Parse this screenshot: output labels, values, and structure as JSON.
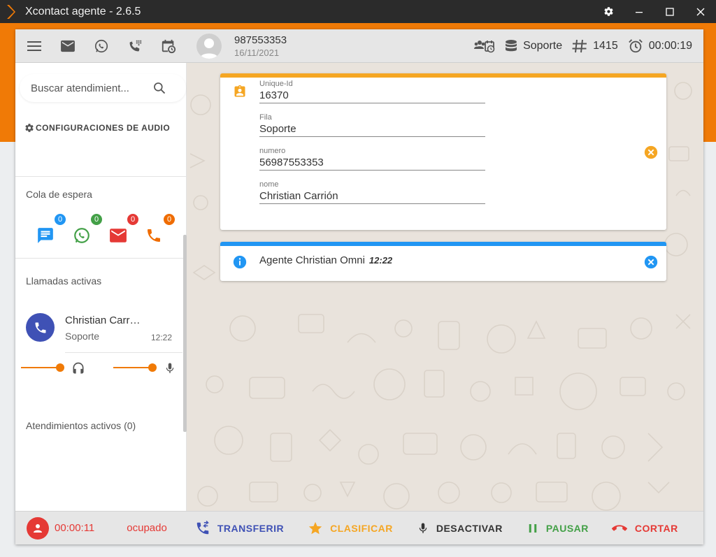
{
  "window": {
    "title": "Xcontact agente - 2.6.5"
  },
  "header": {
    "caller_number": "987553353",
    "caller_date": "16/11/2021",
    "queue": "Soporte",
    "extension": "1415",
    "timer": "00:00:19"
  },
  "sidebar": {
    "search_placeholder": "Buscar atendimient...",
    "audio_config_label": "CONFIGURACIONES DE AUDIO",
    "queue_label": "Cola de espera",
    "queue_counts": [
      {
        "channel": "chat",
        "count": "0",
        "color": "#2196f3"
      },
      {
        "channel": "whatsapp",
        "count": "0",
        "color": "#43a047"
      },
      {
        "channel": "email",
        "count": "0",
        "color": "#e53935"
      },
      {
        "channel": "phone",
        "count": "0",
        "color": "#ef6c00"
      }
    ],
    "active_calls_label": "Llamadas activas",
    "active_call": {
      "name": "Christian Carrión",
      "queue": "Soporte",
      "time": "12:22"
    },
    "headset_volume": 1.0,
    "mic_volume": 1.0,
    "active_attendances_label": "Atendimientos activos (0)"
  },
  "contact_card": {
    "fields": [
      {
        "label": "Unique-Id",
        "value": "16370"
      },
      {
        "label": "Fila",
        "value": "Soporte"
      },
      {
        "label": "numero",
        "value": "56987553353"
      },
      {
        "label": "nome",
        "value": "Christian Carrión"
      }
    ]
  },
  "info_card": {
    "text": "Agente Christian Omni",
    "time": "12:22"
  },
  "footer": {
    "timer": "00:00:11",
    "status": "ocupado",
    "actions": {
      "transfer": "TRANSFERIR",
      "classify": "CLASIFICAR",
      "deactivate": "DESACTIVAR",
      "pause": "PAUSAR",
      "hangup": "CORTAR"
    }
  },
  "colors": {
    "accent_orange": "#f07a06",
    "card_yellow": "#f5a623",
    "info_blue": "#2196f3",
    "transfer_blue": "#3f51b5",
    "busy_red": "#e53935",
    "pause_green": "#43a047"
  }
}
